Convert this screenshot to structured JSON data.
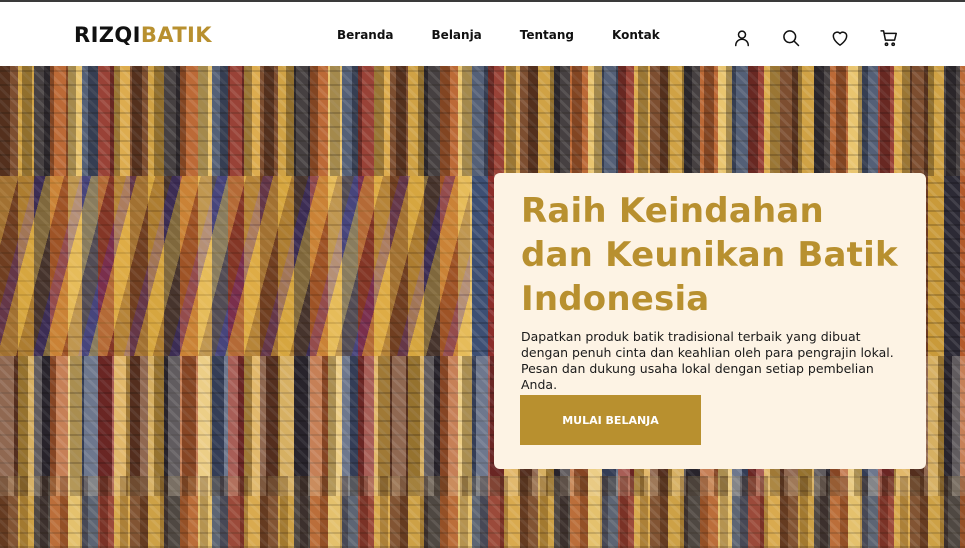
{
  "header": {
    "logo_part1": "RIZQI",
    "logo_part2": "BATIK",
    "nav": [
      "Beranda",
      "Belanja",
      "Tentang",
      "Kontak"
    ],
    "icons": [
      "user-icon",
      "search-icon",
      "heart-icon",
      "cart-icon"
    ]
  },
  "hero": {
    "title": "Raih Keindahan dan Keunikan Batik Indonesia",
    "description": "Dapatkan produk batik tradisional terbaik yang dibuat dengan penuh cinta dan keahlian oleh para pengrajin lokal. Pesan dan dukung usaha lokal dengan setiap pembelian Anda.",
    "cta_label": "MULAI BELANJA"
  },
  "colors": {
    "accent": "#b8902f",
    "card_bg": "#fdf3e4",
    "text_dark": "#111111"
  }
}
